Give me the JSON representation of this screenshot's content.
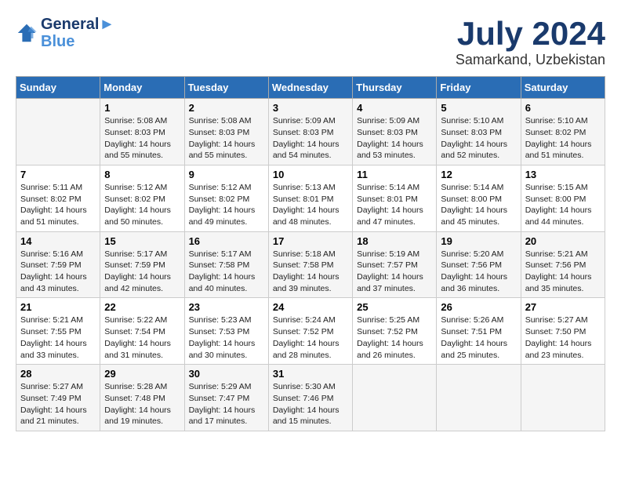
{
  "header": {
    "logo_line1": "General",
    "logo_line2": "Blue",
    "month_year": "July 2024",
    "location": "Samarkand, Uzbekistan"
  },
  "days_of_week": [
    "Sunday",
    "Monday",
    "Tuesday",
    "Wednesday",
    "Thursday",
    "Friday",
    "Saturday"
  ],
  "weeks": [
    [
      {
        "day": "",
        "info": ""
      },
      {
        "day": "1",
        "info": "Sunrise: 5:08 AM\nSunset: 8:03 PM\nDaylight: 14 hours\nand 55 minutes."
      },
      {
        "day": "2",
        "info": "Sunrise: 5:08 AM\nSunset: 8:03 PM\nDaylight: 14 hours\nand 55 minutes."
      },
      {
        "day": "3",
        "info": "Sunrise: 5:09 AM\nSunset: 8:03 PM\nDaylight: 14 hours\nand 54 minutes."
      },
      {
        "day": "4",
        "info": "Sunrise: 5:09 AM\nSunset: 8:03 PM\nDaylight: 14 hours\nand 53 minutes."
      },
      {
        "day": "5",
        "info": "Sunrise: 5:10 AM\nSunset: 8:03 PM\nDaylight: 14 hours\nand 52 minutes."
      },
      {
        "day": "6",
        "info": "Sunrise: 5:10 AM\nSunset: 8:02 PM\nDaylight: 14 hours\nand 51 minutes."
      }
    ],
    [
      {
        "day": "7",
        "info": "Sunrise: 5:11 AM\nSunset: 8:02 PM\nDaylight: 14 hours\nand 51 minutes."
      },
      {
        "day": "8",
        "info": "Sunrise: 5:12 AM\nSunset: 8:02 PM\nDaylight: 14 hours\nand 50 minutes."
      },
      {
        "day": "9",
        "info": "Sunrise: 5:12 AM\nSunset: 8:02 PM\nDaylight: 14 hours\nand 49 minutes."
      },
      {
        "day": "10",
        "info": "Sunrise: 5:13 AM\nSunset: 8:01 PM\nDaylight: 14 hours\nand 48 minutes."
      },
      {
        "day": "11",
        "info": "Sunrise: 5:14 AM\nSunset: 8:01 PM\nDaylight: 14 hours\nand 47 minutes."
      },
      {
        "day": "12",
        "info": "Sunrise: 5:14 AM\nSunset: 8:00 PM\nDaylight: 14 hours\nand 45 minutes."
      },
      {
        "day": "13",
        "info": "Sunrise: 5:15 AM\nSunset: 8:00 PM\nDaylight: 14 hours\nand 44 minutes."
      }
    ],
    [
      {
        "day": "14",
        "info": "Sunrise: 5:16 AM\nSunset: 7:59 PM\nDaylight: 14 hours\nand 43 minutes."
      },
      {
        "day": "15",
        "info": "Sunrise: 5:17 AM\nSunset: 7:59 PM\nDaylight: 14 hours\nand 42 minutes."
      },
      {
        "day": "16",
        "info": "Sunrise: 5:17 AM\nSunset: 7:58 PM\nDaylight: 14 hours\nand 40 minutes."
      },
      {
        "day": "17",
        "info": "Sunrise: 5:18 AM\nSunset: 7:58 PM\nDaylight: 14 hours\nand 39 minutes."
      },
      {
        "day": "18",
        "info": "Sunrise: 5:19 AM\nSunset: 7:57 PM\nDaylight: 14 hours\nand 37 minutes."
      },
      {
        "day": "19",
        "info": "Sunrise: 5:20 AM\nSunset: 7:56 PM\nDaylight: 14 hours\nand 36 minutes."
      },
      {
        "day": "20",
        "info": "Sunrise: 5:21 AM\nSunset: 7:56 PM\nDaylight: 14 hours\nand 35 minutes."
      }
    ],
    [
      {
        "day": "21",
        "info": "Sunrise: 5:21 AM\nSunset: 7:55 PM\nDaylight: 14 hours\nand 33 minutes."
      },
      {
        "day": "22",
        "info": "Sunrise: 5:22 AM\nSunset: 7:54 PM\nDaylight: 14 hours\nand 31 minutes."
      },
      {
        "day": "23",
        "info": "Sunrise: 5:23 AM\nSunset: 7:53 PM\nDaylight: 14 hours\nand 30 minutes."
      },
      {
        "day": "24",
        "info": "Sunrise: 5:24 AM\nSunset: 7:52 PM\nDaylight: 14 hours\nand 28 minutes."
      },
      {
        "day": "25",
        "info": "Sunrise: 5:25 AM\nSunset: 7:52 PM\nDaylight: 14 hours\nand 26 minutes."
      },
      {
        "day": "26",
        "info": "Sunrise: 5:26 AM\nSunset: 7:51 PM\nDaylight: 14 hours\nand 25 minutes."
      },
      {
        "day": "27",
        "info": "Sunrise: 5:27 AM\nSunset: 7:50 PM\nDaylight: 14 hours\nand 23 minutes."
      }
    ],
    [
      {
        "day": "28",
        "info": "Sunrise: 5:27 AM\nSunset: 7:49 PM\nDaylight: 14 hours\nand 21 minutes."
      },
      {
        "day": "29",
        "info": "Sunrise: 5:28 AM\nSunset: 7:48 PM\nDaylight: 14 hours\nand 19 minutes."
      },
      {
        "day": "30",
        "info": "Sunrise: 5:29 AM\nSunset: 7:47 PM\nDaylight: 14 hours\nand 17 minutes."
      },
      {
        "day": "31",
        "info": "Sunrise: 5:30 AM\nSunset: 7:46 PM\nDaylight: 14 hours\nand 15 minutes."
      },
      {
        "day": "",
        "info": ""
      },
      {
        "day": "",
        "info": ""
      },
      {
        "day": "",
        "info": ""
      }
    ]
  ]
}
